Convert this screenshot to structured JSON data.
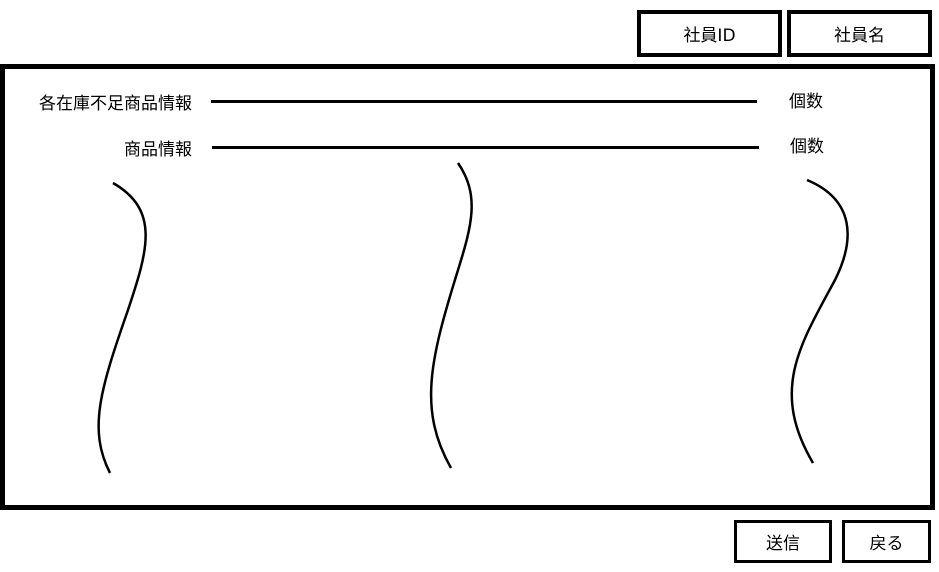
{
  "header": {
    "employee_id_label": "社員ID",
    "employee_name_label": "社員名"
  },
  "main": {
    "rows": [
      {
        "label": "各在庫不足商品情報",
        "count_label": "個数"
      },
      {
        "label": "商品情報",
        "count_label": "個数"
      }
    ]
  },
  "footer": {
    "send_label": "送信",
    "back_label": "戻る"
  }
}
